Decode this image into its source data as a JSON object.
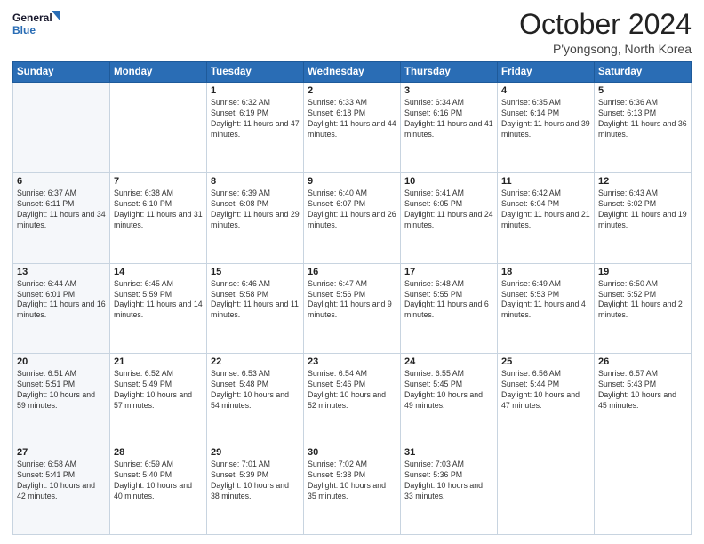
{
  "logo": {
    "line1": "General",
    "line2": "Blue"
  },
  "title": "October 2024",
  "subtitle": "P'yongsong, North Korea",
  "weekdays": [
    "Sunday",
    "Monday",
    "Tuesday",
    "Wednesday",
    "Thursday",
    "Friday",
    "Saturday"
  ],
  "weeks": [
    [
      {
        "day": "",
        "text": ""
      },
      {
        "day": "",
        "text": ""
      },
      {
        "day": "1",
        "text": "Sunrise: 6:32 AM\nSunset: 6:19 PM\nDaylight: 11 hours and 47 minutes."
      },
      {
        "day": "2",
        "text": "Sunrise: 6:33 AM\nSunset: 6:18 PM\nDaylight: 11 hours and 44 minutes."
      },
      {
        "day": "3",
        "text": "Sunrise: 6:34 AM\nSunset: 6:16 PM\nDaylight: 11 hours and 41 minutes."
      },
      {
        "day": "4",
        "text": "Sunrise: 6:35 AM\nSunset: 6:14 PM\nDaylight: 11 hours and 39 minutes."
      },
      {
        "day": "5",
        "text": "Sunrise: 6:36 AM\nSunset: 6:13 PM\nDaylight: 11 hours and 36 minutes."
      }
    ],
    [
      {
        "day": "6",
        "text": "Sunrise: 6:37 AM\nSunset: 6:11 PM\nDaylight: 11 hours and 34 minutes."
      },
      {
        "day": "7",
        "text": "Sunrise: 6:38 AM\nSunset: 6:10 PM\nDaylight: 11 hours and 31 minutes."
      },
      {
        "day": "8",
        "text": "Sunrise: 6:39 AM\nSunset: 6:08 PM\nDaylight: 11 hours and 29 minutes."
      },
      {
        "day": "9",
        "text": "Sunrise: 6:40 AM\nSunset: 6:07 PM\nDaylight: 11 hours and 26 minutes."
      },
      {
        "day": "10",
        "text": "Sunrise: 6:41 AM\nSunset: 6:05 PM\nDaylight: 11 hours and 24 minutes."
      },
      {
        "day": "11",
        "text": "Sunrise: 6:42 AM\nSunset: 6:04 PM\nDaylight: 11 hours and 21 minutes."
      },
      {
        "day": "12",
        "text": "Sunrise: 6:43 AM\nSunset: 6:02 PM\nDaylight: 11 hours and 19 minutes."
      }
    ],
    [
      {
        "day": "13",
        "text": "Sunrise: 6:44 AM\nSunset: 6:01 PM\nDaylight: 11 hours and 16 minutes."
      },
      {
        "day": "14",
        "text": "Sunrise: 6:45 AM\nSunset: 5:59 PM\nDaylight: 11 hours and 14 minutes."
      },
      {
        "day": "15",
        "text": "Sunrise: 6:46 AM\nSunset: 5:58 PM\nDaylight: 11 hours and 11 minutes."
      },
      {
        "day": "16",
        "text": "Sunrise: 6:47 AM\nSunset: 5:56 PM\nDaylight: 11 hours and 9 minutes."
      },
      {
        "day": "17",
        "text": "Sunrise: 6:48 AM\nSunset: 5:55 PM\nDaylight: 11 hours and 6 minutes."
      },
      {
        "day": "18",
        "text": "Sunrise: 6:49 AM\nSunset: 5:53 PM\nDaylight: 11 hours and 4 minutes."
      },
      {
        "day": "19",
        "text": "Sunrise: 6:50 AM\nSunset: 5:52 PM\nDaylight: 11 hours and 2 minutes."
      }
    ],
    [
      {
        "day": "20",
        "text": "Sunrise: 6:51 AM\nSunset: 5:51 PM\nDaylight: 10 hours and 59 minutes."
      },
      {
        "day": "21",
        "text": "Sunrise: 6:52 AM\nSunset: 5:49 PM\nDaylight: 10 hours and 57 minutes."
      },
      {
        "day": "22",
        "text": "Sunrise: 6:53 AM\nSunset: 5:48 PM\nDaylight: 10 hours and 54 minutes."
      },
      {
        "day": "23",
        "text": "Sunrise: 6:54 AM\nSunset: 5:46 PM\nDaylight: 10 hours and 52 minutes."
      },
      {
        "day": "24",
        "text": "Sunrise: 6:55 AM\nSunset: 5:45 PM\nDaylight: 10 hours and 49 minutes."
      },
      {
        "day": "25",
        "text": "Sunrise: 6:56 AM\nSunset: 5:44 PM\nDaylight: 10 hours and 47 minutes."
      },
      {
        "day": "26",
        "text": "Sunrise: 6:57 AM\nSunset: 5:43 PM\nDaylight: 10 hours and 45 minutes."
      }
    ],
    [
      {
        "day": "27",
        "text": "Sunrise: 6:58 AM\nSunset: 5:41 PM\nDaylight: 10 hours and 42 minutes."
      },
      {
        "day": "28",
        "text": "Sunrise: 6:59 AM\nSunset: 5:40 PM\nDaylight: 10 hours and 40 minutes."
      },
      {
        "day": "29",
        "text": "Sunrise: 7:01 AM\nSunset: 5:39 PM\nDaylight: 10 hours and 38 minutes."
      },
      {
        "day": "30",
        "text": "Sunrise: 7:02 AM\nSunset: 5:38 PM\nDaylight: 10 hours and 35 minutes."
      },
      {
        "day": "31",
        "text": "Sunrise: 7:03 AM\nSunset: 5:36 PM\nDaylight: 10 hours and 33 minutes."
      },
      {
        "day": "",
        "text": ""
      },
      {
        "day": "",
        "text": ""
      }
    ]
  ]
}
